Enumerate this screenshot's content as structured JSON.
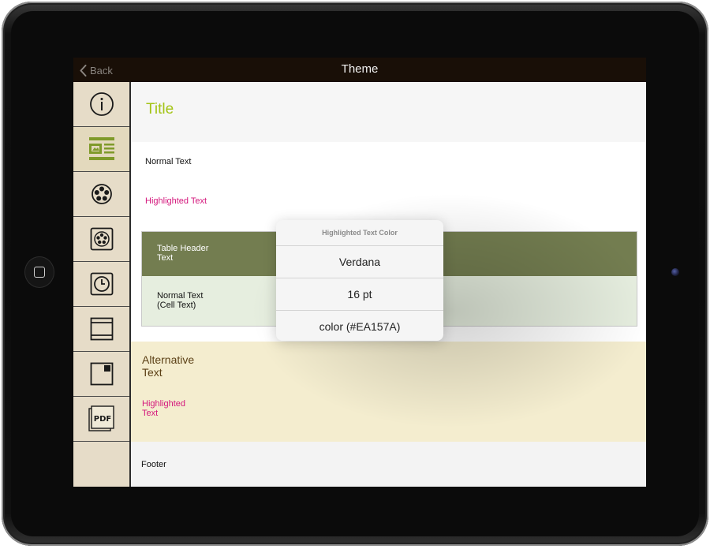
{
  "navbar": {
    "back_label": "Back",
    "title": "Theme"
  },
  "sidebar": {
    "items": [
      {
        "icon": "info-icon",
        "active": false
      },
      {
        "icon": "layout-icon",
        "active": true
      },
      {
        "icon": "palette-icon",
        "active": false
      },
      {
        "icon": "palette-box-icon",
        "active": false
      },
      {
        "icon": "clock-icon",
        "active": false
      },
      {
        "icon": "header-footer-icon",
        "active": false
      },
      {
        "icon": "corner-block-icon",
        "active": false
      },
      {
        "icon": "pdf-icon",
        "active": false
      }
    ]
  },
  "preview": {
    "title": "Title",
    "normal_text": "Normal Text",
    "highlighted_text": "Highlighted Text",
    "table_header_line1": "Table Header",
    "table_header_line2": "Text",
    "table_cell_line1": "Normal Text",
    "table_cell_line2": "(Cell Text)",
    "alternative_line1": "Alternative",
    "alternative_line2": "Text",
    "alt_highlighted_line1": "Highlighted",
    "alt_highlighted_line2": "Text",
    "footer": "Footer"
  },
  "popover": {
    "header": "Highlighted Text Color",
    "font": "Verdana",
    "size": "16 pt",
    "color": "color (#EA157A)"
  },
  "colors": {
    "title": "#a3c415",
    "highlight": "#d4177c",
    "table_header_bg": "#737d50",
    "alt_band_bg": "#f4edcf",
    "sidebar_bg": "#e6dcc8"
  }
}
